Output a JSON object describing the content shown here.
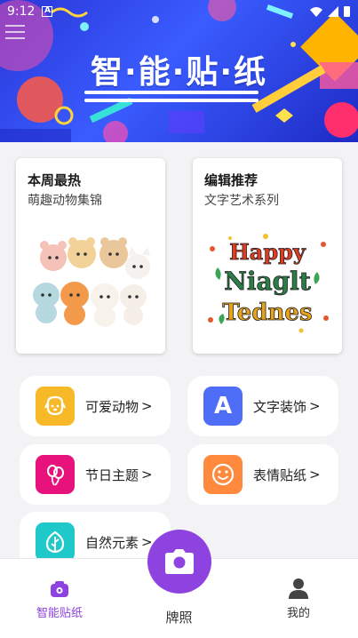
{
  "status": {
    "time": "9:12",
    "badge": "A"
  },
  "banner": {
    "title": "智·能·贴·纸"
  },
  "featured": [
    {
      "title": "本周最热",
      "subtitle": "萌趣动物集锦"
    },
    {
      "title": "编辑推荐",
      "subtitle": "文字艺术系列",
      "art_text": [
        "Happy",
        "Niaglt",
        "Tednes"
      ]
    }
  ],
  "categories": [
    {
      "label": "可爱动物",
      "color": "#f7b928"
    },
    {
      "label": "文字装饰",
      "color": "#4f6ef7",
      "glyph": "A"
    },
    {
      "label": "节日主题",
      "color": "#e8127c"
    },
    {
      "label": "表情贴纸",
      "color": "#ff8a3d"
    },
    {
      "label": "自然元素",
      "color": "#1fc9c9"
    }
  ],
  "chevron": ">",
  "nav": {
    "home_label": "智能贴纸",
    "camera_label": "牌照",
    "profile_label": "我的",
    "accent": "#8e43e0"
  }
}
